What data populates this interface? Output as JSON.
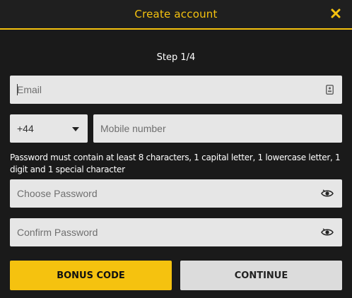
{
  "header": {
    "title": "Create account",
    "close_icon": "close-icon",
    "accent_color": "#f5c20f"
  },
  "step": "Step 1/4",
  "form": {
    "email": {
      "placeholder": "Email",
      "value": "",
      "icon": "contact-card-icon"
    },
    "country_code": {
      "value": "+44",
      "icon": "chevron-down-icon"
    },
    "mobile": {
      "placeholder": "Mobile number",
      "value": ""
    },
    "password_hint": "Password must contain at least 8 characters, 1 capital letter, 1 lowercase letter, 1 digit and 1 special character",
    "password": {
      "placeholder": "Choose Password",
      "value": "",
      "icon": "eye-toggle-icon"
    },
    "confirm_password": {
      "placeholder": "Confirm Password",
      "value": "",
      "icon": "eye-toggle-icon"
    }
  },
  "buttons": {
    "bonus_code": "BONUS CODE",
    "continue": "CONTINUE"
  }
}
